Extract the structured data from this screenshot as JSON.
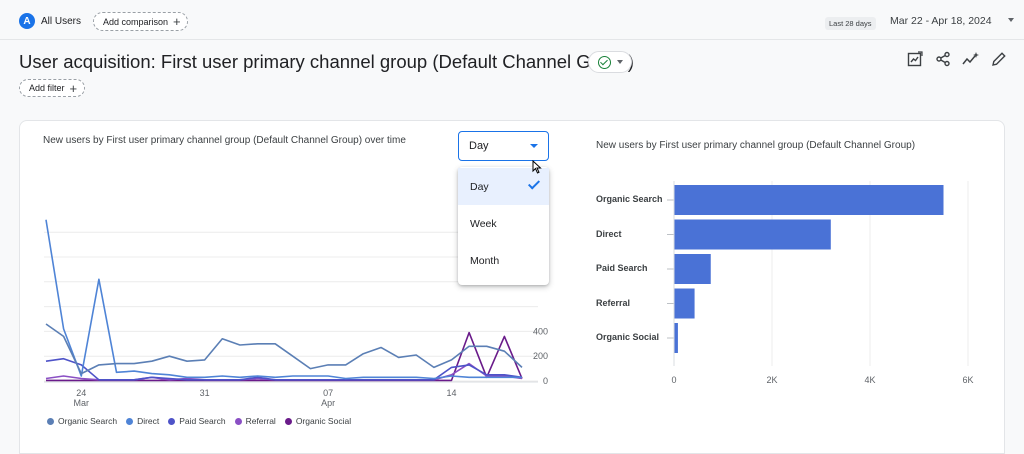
{
  "header": {
    "segment": {
      "avatar_letter": "A",
      "label": "All Users"
    },
    "comparison_label": "Add comparison",
    "date_preset": "Last 28 days",
    "date_range": "Mar 22 - Apr 18, 2024"
  },
  "report": {
    "title": "User acquisition: First user primary channel group (Default Channel Group)",
    "status_icon": "check-circle-icon",
    "filter_label": "Add filter",
    "toolbar": [
      "edit-report-icon",
      "share-icon",
      "insights-icon",
      "pencil-icon"
    ]
  },
  "line_card": {
    "title": "New users by First user primary channel group (Default Channel Group) over time",
    "period_select": "Day",
    "period_options": [
      "Day",
      "Week",
      "Month"
    ],
    "selected_option": "Day"
  },
  "bar_card": {
    "title": "New users by First user primary channel group (Default Channel Group)"
  },
  "chart_data": [
    {
      "type": "line",
      "title": "New users by First user primary channel group (Default Channel Group) over time",
      "x": [
        "Mar 22",
        "Mar 23",
        "Mar 24",
        "Mar 25",
        "Mar 26",
        "Mar 27",
        "Mar 28",
        "Mar 29",
        "Mar 30",
        "Mar 31",
        "Apr 01",
        "Apr 02",
        "Apr 03",
        "Apr 04",
        "Apr 05",
        "Apr 06",
        "Apr 07",
        "Apr 08",
        "Apr 09",
        "Apr 10",
        "Apr 11",
        "Apr 12",
        "Apr 13",
        "Apr 14",
        "Apr 15",
        "Apr 16",
        "Apr 17",
        "Apr 18"
      ],
      "x_tick_labels": [
        {
          "label": "24",
          "sublabel": "Mar",
          "at": "Mar 24"
        },
        {
          "label": "31",
          "sublabel": "",
          "at": "Mar 31"
        },
        {
          "label": "07",
          "sublabel": "Apr",
          "at": "Apr 07"
        },
        {
          "label": "14",
          "sublabel": "",
          "at": "Apr 14"
        }
      ],
      "y_tick_labels": [
        "0",
        "200",
        "400"
      ],
      "ylim": [
        0,
        1400
      ],
      "legend_position": "bottom",
      "series": [
        {
          "name": "Organic Search",
          "color": "#5b7fb5",
          "values": [
            460,
            360,
            60,
            130,
            140,
            140,
            160,
            200,
            160,
            170,
            340,
            290,
            300,
            300,
            200,
            100,
            130,
            130,
            220,
            270,
            190,
            210,
            110,
            170,
            280,
            280,
            240,
            110
          ]
        },
        {
          "name": "Direct",
          "color": "#4f84d6",
          "values": [
            1300,
            420,
            40,
            820,
            70,
            80,
            60,
            50,
            30,
            30,
            40,
            30,
            40,
            30,
            40,
            40,
            40,
            20,
            30,
            30,
            30,
            30,
            20,
            40,
            30,
            30,
            30,
            30
          ]
        },
        {
          "name": "Paid Search",
          "color": "#4e53c8",
          "values": [
            160,
            180,
            130,
            10,
            10,
            10,
            30,
            20,
            10,
            10,
            10,
            10,
            30,
            10,
            10,
            10,
            10,
            10,
            10,
            10,
            10,
            10,
            10,
            110,
            130,
            50,
            50,
            30
          ]
        },
        {
          "name": "Referral",
          "color": "#8a4fc4",
          "values": [
            20,
            40,
            20,
            10,
            10,
            10,
            30,
            10,
            20,
            10,
            10,
            10,
            20,
            10,
            10,
            10,
            10,
            10,
            10,
            10,
            10,
            10,
            10,
            50,
            140,
            40,
            40,
            20
          ]
        },
        {
          "name": "Organic Social",
          "color": "#6a1b8a",
          "values": [
            5,
            5,
            5,
            5,
            5,
            5,
            5,
            5,
            5,
            5,
            5,
            5,
            5,
            5,
            5,
            5,
            5,
            5,
            5,
            5,
            5,
            5,
            5,
            5,
            390,
            30,
            360,
            20
          ]
        }
      ]
    },
    {
      "type": "bar",
      "orientation": "horizontal",
      "title": "New users by First user primary channel group (Default Channel Group)",
      "categories": [
        "Organic Search",
        "Direct",
        "Paid Search",
        "Referral",
        "Organic Social"
      ],
      "values": [
        5500,
        3200,
        750,
        420,
        80
      ],
      "xlim": [
        0,
        6000
      ],
      "x_tick_labels": [
        "0",
        "2K",
        "4K",
        "6K"
      ],
      "grid": true,
      "color": "#4a72d6"
    }
  ]
}
